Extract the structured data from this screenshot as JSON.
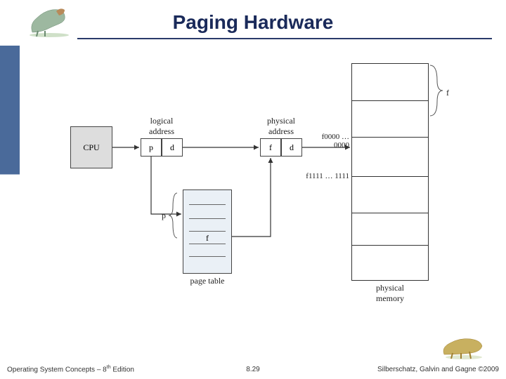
{
  "title": "Paging Hardware",
  "diagram": {
    "cpu": "CPU",
    "logical_address_label": "logical\naddress",
    "physical_address_label": "physical\naddress",
    "p": "p",
    "d": "d",
    "f": "f",
    "page_table_label": "page table",
    "page_table_p": "p",
    "page_table_f": "f",
    "phys_mem_label": "physical\nmemory",
    "frame_top": "f0000 … 0000",
    "frame_bottom": "f1111 … 1111",
    "brace_f": "f"
  },
  "footer": {
    "left_prefix": "Operating System Concepts – 8",
    "left_suffix": " Edition",
    "left_sup": "th",
    "center": "8.29",
    "right": "Silberschatz, Galvin and Gagne ©2009"
  },
  "colors": {
    "title": "#1a2a5a",
    "sidebar": "#4a6a9a",
    "box_fill": "#f2f2f2",
    "pagetable_fill": "#eaf0f6"
  }
}
